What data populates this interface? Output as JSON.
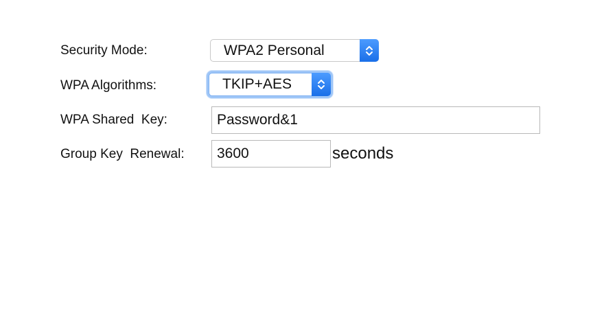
{
  "form": {
    "security_mode": {
      "label": "Security Mode:",
      "value": "WPA2 Personal",
      "icon": "chevron-up-down-icon"
    },
    "wpa_algorithms": {
      "label": "WPA Algorithms:",
      "value": "TKIP+AES",
      "icon": "chevron-up-down-icon"
    },
    "wpa_shared_key": {
      "label": "WPA Shared  Key:",
      "value": "Password&1"
    },
    "group_key_renewal": {
      "label": "Group Key  Renewal:",
      "value": "3600",
      "unit": "seconds"
    }
  },
  "colors": {
    "accent": "#1a6fe8",
    "focus_ring": "#9fc6f7"
  }
}
